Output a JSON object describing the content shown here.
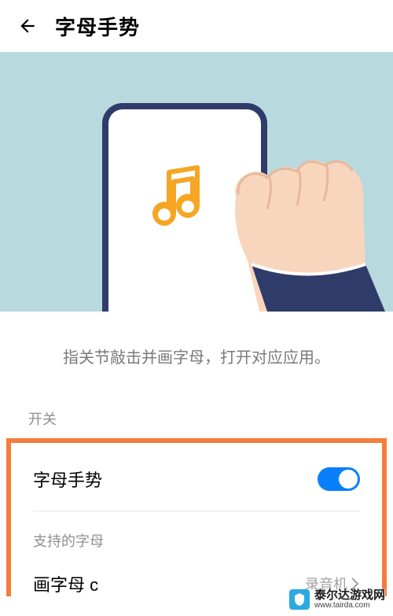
{
  "header": {
    "title": "字母手势"
  },
  "hero": {
    "icon": "music-note"
  },
  "description": "指关节敲击并画字母，打开对应应用。",
  "sections": {
    "switch_label": "开关",
    "toggle": {
      "label": "字母手势",
      "value": true
    },
    "supported_label": "支持的字母",
    "items": [
      {
        "label": "画字母 c",
        "value": "录音机"
      }
    ]
  },
  "watermark": {
    "name": "泰尔达游戏网",
    "url": "www.tairda.com"
  }
}
